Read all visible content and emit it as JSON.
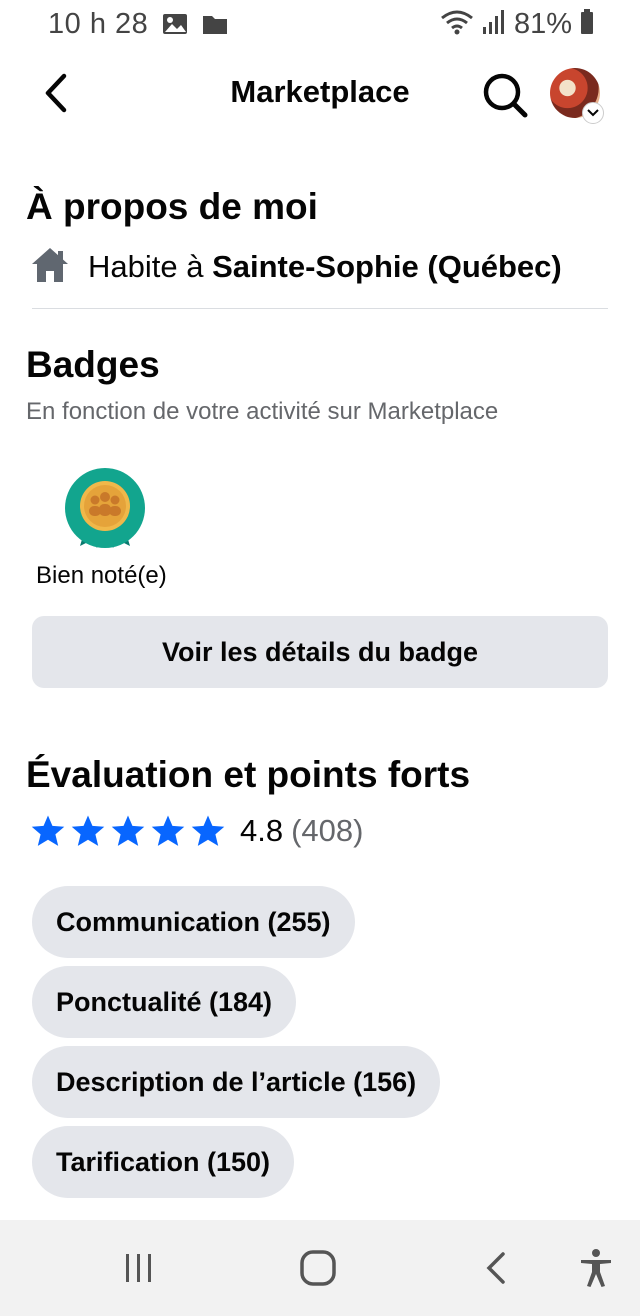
{
  "status_bar": {
    "time": "10 h 28",
    "battery": "81%"
  },
  "header": {
    "title": "Marketplace"
  },
  "about": {
    "title": "À propos de moi",
    "lives_prefix": "Habite à ",
    "location": "Sainte-Sophie (Québec)"
  },
  "badges": {
    "title": "Badges",
    "subtitle": "En fonction de votre activité sur Marketplace",
    "items": [
      {
        "label": "Bien noté(e)"
      }
    ],
    "details_button": "Voir les détails du badge"
  },
  "ratings": {
    "title": "Évaluation et points forts",
    "stars": 5,
    "value": "4.8",
    "count": "(408)",
    "highlights": [
      {
        "label": "Communication (255)"
      },
      {
        "label": "Ponctualité (184)"
      },
      {
        "label": "Description de l’article (156)"
      },
      {
        "label": "Tarification (150)"
      }
    ]
  },
  "colors": {
    "accent": "#0866ff",
    "chip_bg": "#e4e6eb",
    "secondary_text": "#65676b"
  }
}
